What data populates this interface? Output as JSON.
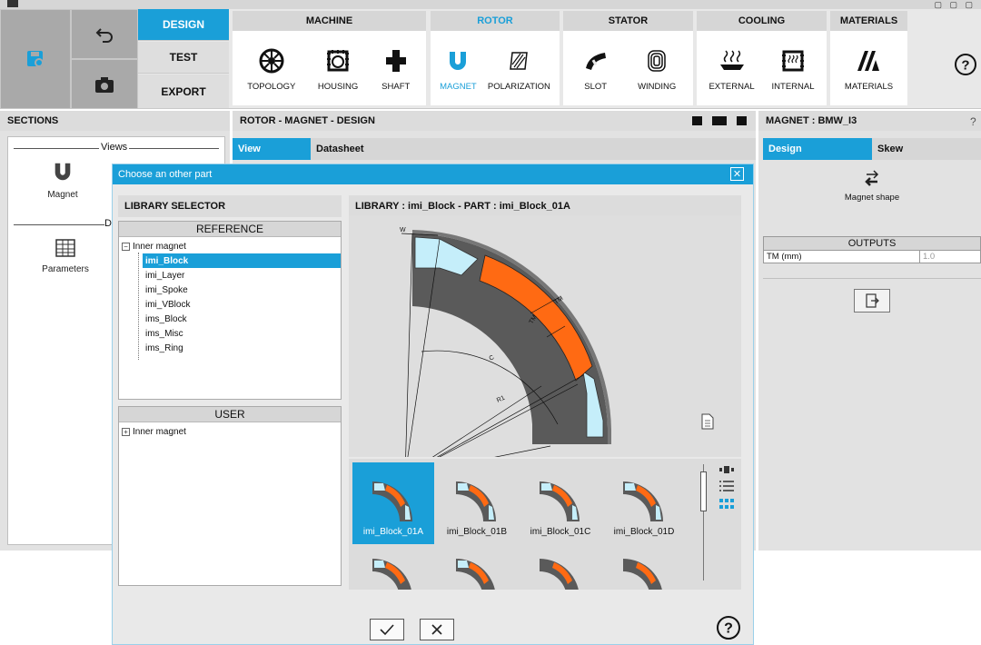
{
  "ribbon": {
    "mode_buttons": [
      "DESIGN",
      "TEST",
      "EXPORT"
    ],
    "groups": [
      {
        "title": "MACHINE",
        "items": [
          "TOPOLOGY",
          "HOUSING",
          "SHAFT"
        ]
      },
      {
        "title": "ROTOR",
        "items": [
          "MAGNET",
          "POLARIZATION"
        ]
      },
      {
        "title": "STATOR",
        "items": [
          "SLOT",
          "WINDING"
        ]
      },
      {
        "title": "COOLING",
        "items": [
          "EXTERNAL",
          "INTERNAL"
        ]
      },
      {
        "title": "MATERIALS",
        "items": [
          "MATERIALS"
        ]
      }
    ],
    "active_group": "ROTOR",
    "active_item": "MAGNET"
  },
  "sections": {
    "title": "SECTIONS",
    "group_views": "Views",
    "group_d": "D",
    "items": [
      "Magnet",
      "Parameters"
    ]
  },
  "center": {
    "title": "ROTOR - MAGNET - DESIGN",
    "tabs": [
      "View",
      "Datasheet"
    ]
  },
  "right": {
    "title": "MAGNET : BMW_I3",
    "help": "?",
    "tabs": [
      "Design",
      "Skew"
    ],
    "shape_label": "Magnet shape",
    "outputs_title": "OUTPUTS",
    "outputs": [
      {
        "name": "TM (mm)",
        "value": "1.0"
      }
    ]
  },
  "dialog": {
    "title": "Choose an other part",
    "close": "✕",
    "selector_title": "LIBRARY SELECTOR",
    "reference_title": "REFERENCE",
    "reference_root": "Inner magnet",
    "reference_items": [
      "imi_Block",
      "imi_Layer",
      "imi_Spoke",
      "imi_VBlock",
      "ims_Block",
      "ims_Misc",
      "ims_Ring"
    ],
    "reference_selected": "imi_Block",
    "user_title": "USER",
    "user_root": "Inner magnet",
    "library_label": "LIBRARY : imi_Block   -   PART : imi_Block_01A",
    "drawing_labels": {
      "w": "W",
      "tm": "TM",
      "tm2": "TM",
      "c": "C",
      "r1": "R1"
    },
    "thumbnails": [
      "imi_Block_01A",
      "imi_Block_01B",
      "imi_Block_01C",
      "imi_Block_01D"
    ],
    "selected_thumbnail": "imi_Block_01A",
    "ok_icon": "check-icon",
    "cancel_icon": "x-icon",
    "help": "?"
  },
  "colors": {
    "accent": "#1a9fd8",
    "magnet": "#ff6a13",
    "lamination": "#5a5a5a",
    "air": "#c5eefa"
  }
}
